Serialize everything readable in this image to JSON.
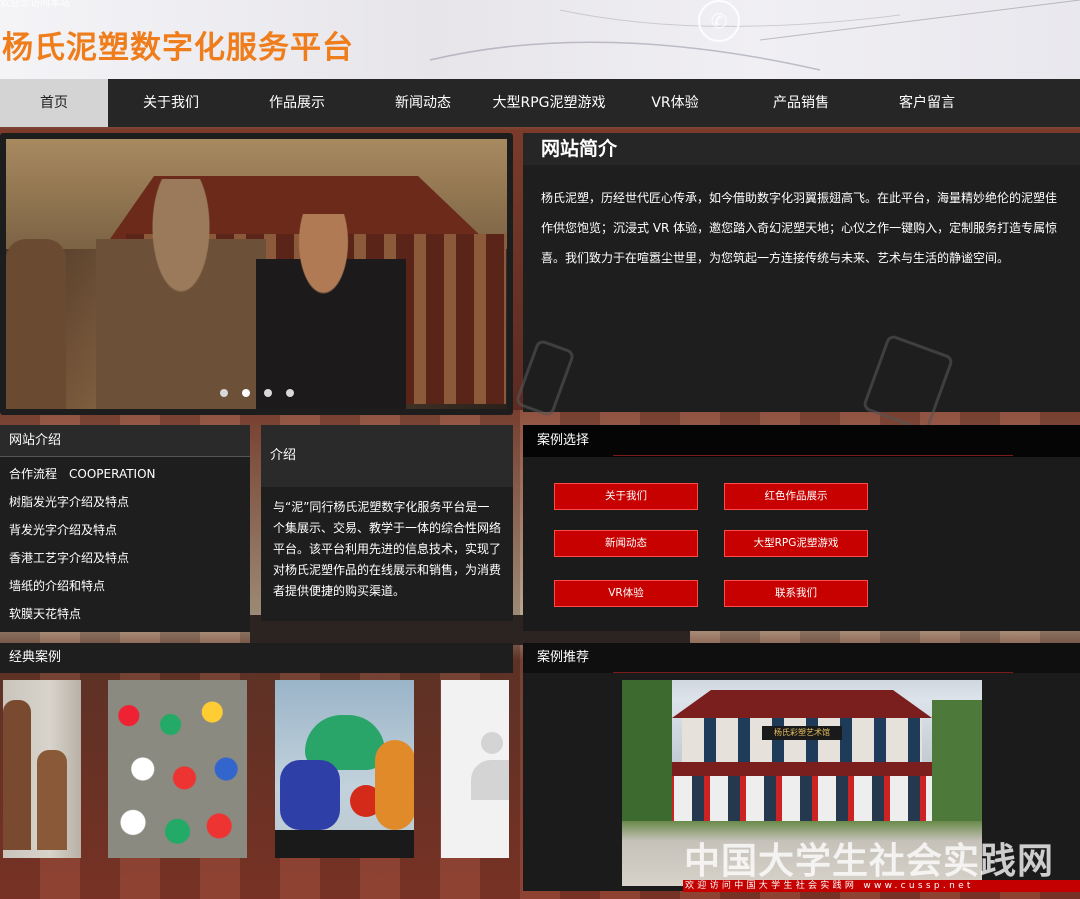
{
  "header": {
    "top_text": "欢迎您访问本站",
    "site_title": "杨氏泥塑数字化服务平台"
  },
  "nav": {
    "items": [
      {
        "label": "首页",
        "active": true
      },
      {
        "label": "关于我们"
      },
      {
        "label": "作品展示"
      },
      {
        "label": "新闻动态"
      },
      {
        "label": "大型RPG泥塑游戏"
      },
      {
        "label": "VR体验"
      },
      {
        "label": "产品销售"
      },
      {
        "label": "客户留言"
      }
    ]
  },
  "slider": {
    "slide_count": 4,
    "active_index": 1
  },
  "intro": {
    "title": "网站简介",
    "text": "杨氏泥塑，历经世代匠心传承，如今借助数字化羽翼振翅高飞。在此平台，海量精妙绝伦的泥塑佳作供您饱览；沉浸式 VR 体验，邀您踏入奇幻泥塑天地；心仪之作一键购入，定制服务打造专属惊喜。我们致力于在喧嚣尘世里，为您筑起一方连接传统与未来、艺术与生活的静谧空间。"
  },
  "about": {
    "title": "网站介绍",
    "items": [
      "合作流程　COOPERATION",
      "树脂发光字介绍及特点",
      "背发光字介绍及特点",
      "香港工艺字介绍及特点",
      "墙纸的介绍和特点",
      "软膜天花特点"
    ]
  },
  "mid": {
    "title": "介绍",
    "text": "与“泥”同行杨氏泥塑数字化服务平台是一个集展示、交易、教学于一体的综合性网络平台。该平台利用先进的信息技术，实现了对杨氏泥塑作品的在线展示和销售，为消费者提供便捷的购买渠道。"
  },
  "cases": {
    "title": "案例选择",
    "buttons": [
      "关于我们",
      "红色作品展示",
      "新闻动态",
      "大型RPG泥塑游戏",
      "VR体验",
      "联系我们"
    ]
  },
  "classic": {
    "title": "经典案例"
  },
  "recommend": {
    "title": "案例推荐",
    "plaque": "杨氏彩塑艺术馆"
  },
  "watermark": {
    "text": "中国大学生社会实践网",
    "bar_text": "欢迎访问中国大学生社会实践网 www.cussp.net"
  },
  "colors": {
    "title_orange": "#ef7d1b",
    "nav_bg": "#262626",
    "nav_active": "#d4d4d4",
    "case_button": "#c70000",
    "panel_bg": "#1e1e1e"
  }
}
